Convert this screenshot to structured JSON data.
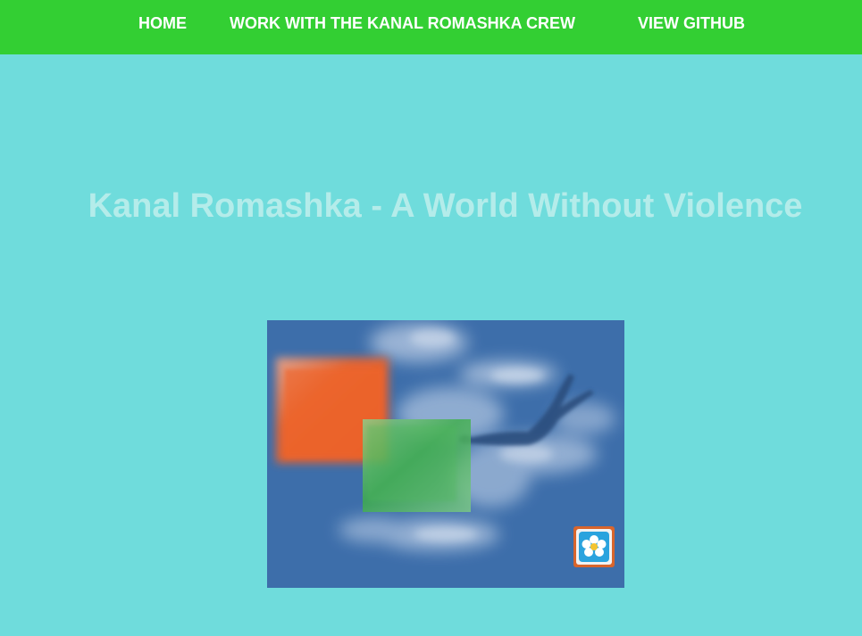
{
  "nav": {
    "items": [
      {
        "label": "HOME"
      },
      {
        "label": "WORK WITH THE KANAL ROMASHKA CREW"
      },
      {
        "label": "VIEW GITHUB"
      }
    ]
  },
  "main": {
    "title": "Kanal Romashka - A World Without Violence"
  },
  "hero_image": {
    "icon": "daisy-flower-icon"
  },
  "colors": {
    "page_background": "#6fdcdc",
    "navbar": "#33cf33",
    "title_text": "#b4ecea",
    "sky": "#3d6eaa",
    "orange_panel": "#f0642a",
    "green_panel": "#5cc060"
  }
}
